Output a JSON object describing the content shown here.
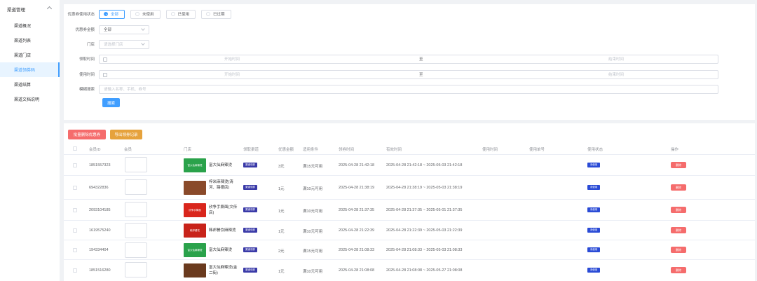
{
  "sidebar": {
    "group_label": "渠道管理",
    "items": [
      {
        "label": "渠道概况",
        "active": false
      },
      {
        "label": "渠道列表",
        "active": false
      },
      {
        "label": "渠道门店",
        "active": false
      },
      {
        "label": "渠道领券码",
        "active": true
      },
      {
        "label": "渠道结算",
        "active": false
      },
      {
        "label": "渠道文档说明",
        "active": false
      }
    ]
  },
  "filters": {
    "status_label": "优惠券使用状态",
    "status_options": [
      "全部",
      "未使用",
      "已使用",
      "已过期"
    ],
    "status_selected": "全部",
    "amount_label": "优惠券金额",
    "amount_value": "全部",
    "store_label": "门店",
    "store_placeholder": "请选择门店",
    "receive_time_label": "领取时间",
    "use_time_label": "使用时间",
    "date_start_placeholder": "开始时间",
    "date_separator": "至",
    "date_end_placeholder": "结束时间",
    "keyword_label": "模糊搜索",
    "keyword_placeholder": "请输入名称、手机、券号",
    "search_button": "搜索"
  },
  "toolbar": {
    "batch_delete": "批量删除优惠券",
    "export_records": "导出领券记录"
  },
  "table": {
    "headers": [
      "会员ID",
      "会员",
      "门店",
      "领取渠道",
      "优惠金额",
      "适用条件",
      "领券时间",
      "有效时间",
      "使用时间",
      "使用单号",
      "使用状态",
      "操作"
    ],
    "rows": [
      {
        "member_id": "1851557323",
        "store": "富大仙麻辣烫",
        "thumb_text": "富大仙麻辣烫",
        "thumb_color": "#2aa24b",
        "channel": "渠道领券",
        "amount": "3元",
        "condition": "满15元可用",
        "receive_time": "2025-04-28 21:42:18",
        "valid_time": "2025-04-28 21:42:18 ~ 2025-05-03 21:42:18",
        "use_time": "",
        "order_no": "",
        "status": "未使用",
        "action": "删除"
      },
      {
        "member_id": "694322836",
        "store": "梓米麻辣烫(清河、路德店)",
        "thumb_text": "",
        "thumb_color": "#8a4a2a",
        "channel": "渠道领券",
        "amount": "1元",
        "condition": "满10元可用",
        "receive_time": "2025-04-28 21:38:19",
        "valid_time": "2025-04-28 21:38:19 ~ 2025-05-03 21:38:19",
        "use_time": "",
        "order_no": "",
        "status": "未使用",
        "action": "删除"
      },
      {
        "member_id": "2093104185",
        "store": "欣争手擀面(文传店)",
        "thumb_text": "欣争手擀面",
        "thumb_color": "#d9261c",
        "channel": "渠道领券",
        "amount": "1元",
        "condition": "满10元可用",
        "receive_time": "2025-04-28 21:37:35",
        "valid_time": "2025-04-28 21:37:35 ~ 2025-05-01 21:37:35",
        "use_time": "",
        "order_no": "",
        "status": "未使用",
        "action": "删除"
      },
      {
        "member_id": "1619575240",
        "store": "韩邦餐饮麻辣烫",
        "thumb_text": "韩邦餐饮",
        "thumb_color": "#c8231a",
        "channel": "渠道领券",
        "amount": "1元",
        "condition": "满10元可用",
        "receive_time": "2025-04-28 21:22:39",
        "valid_time": "2025-04-28 21:22:39 ~ 2025-05-03 21:22:39",
        "use_time": "",
        "order_no": "",
        "status": "未使用",
        "action": "删除"
      },
      {
        "member_id": "194334404",
        "store": "富大仙麻辣烫",
        "thumb_text": "富大仙麻辣烫",
        "thumb_color": "#2aa24b",
        "channel": "渠道领券",
        "amount": "2元",
        "condition": "满15元可用",
        "receive_time": "2025-04-28 21:08:33",
        "valid_time": "2025-04-28 21:08:33 ~ 2025-05-03 21:08:33",
        "use_time": "",
        "order_no": "",
        "status": "未使用",
        "action": "删除"
      },
      {
        "member_id": "1851516280",
        "store": "富大仙麻辣烫(金二街)",
        "thumb_text": "",
        "thumb_color": "#6a3a1e",
        "channel": "渠道领券",
        "amount": "1元",
        "condition": "满10元可用",
        "receive_time": "2025-04-28 21:08:08",
        "valid_time": "2025-04-28 21:08:08 ~ 2025-05-27 21:08:08",
        "use_time": "",
        "order_no": "",
        "status": "未使用",
        "action": "删除"
      }
    ]
  }
}
